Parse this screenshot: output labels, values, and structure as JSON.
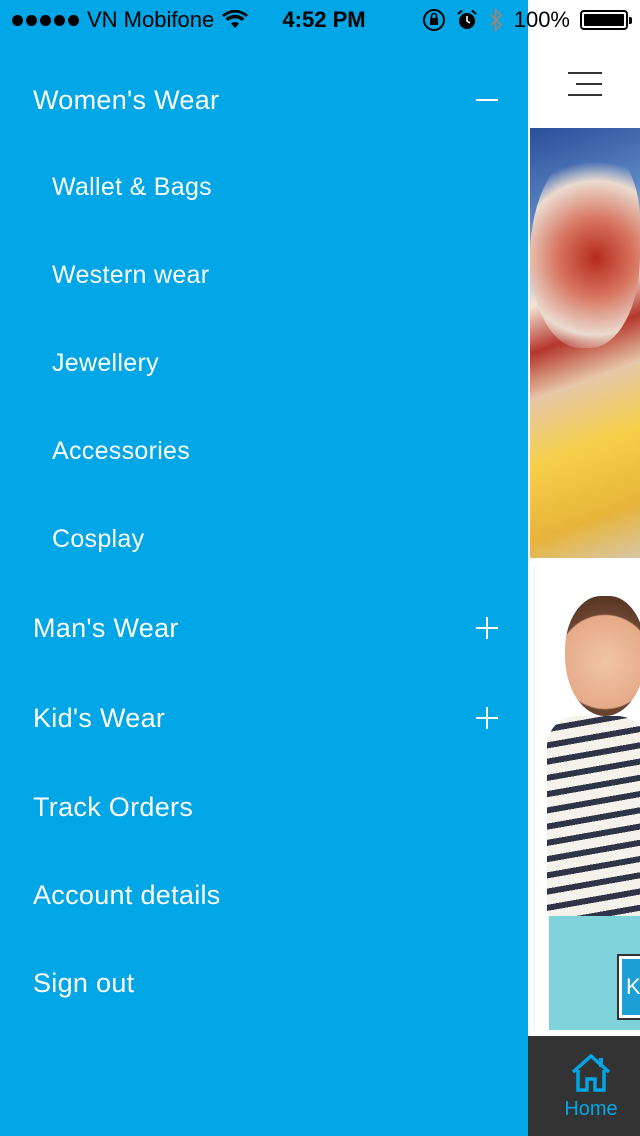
{
  "status_bar": {
    "carrier": "VN Mobifone",
    "time": "4:52 PM",
    "battery": "100%"
  },
  "drawer": {
    "items": [
      {
        "label": "Women's Wear",
        "toggle": "minus"
      },
      {
        "label": "Wallet & Bags"
      },
      {
        "label": "Western wear"
      },
      {
        "label": "Jewellery"
      },
      {
        "label": "Accessories"
      },
      {
        "label": "Cosplay"
      },
      {
        "label": "Man's Wear",
        "toggle": "plus"
      },
      {
        "label": "Kid's Wear",
        "toggle": "plus"
      },
      {
        "label": "Track Orders"
      },
      {
        "label": "Account details"
      },
      {
        "label": "Sign out"
      }
    ]
  },
  "main": {
    "banner_badge": "K",
    "tabbar": {
      "home_label": "Home"
    }
  },
  "colors": {
    "drawer_bg": "#00a6e6",
    "tabbar_bg": "#333333",
    "accent": "#00a6e6"
  }
}
